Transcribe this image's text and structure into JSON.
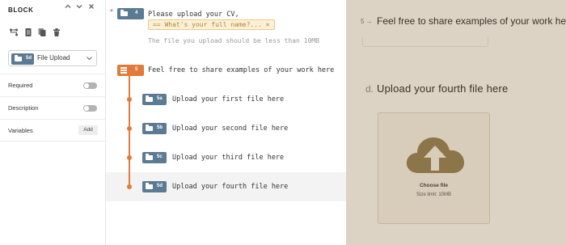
{
  "block_panel": {
    "title": "BLOCK",
    "header_icons": [
      "chevron-up-icon",
      "chevron-down-icon",
      "close-icon"
    ],
    "tools": [
      "branch-icon",
      "document-icon",
      "duplicate-icon",
      "trash-icon"
    ],
    "block_type": {
      "badge": "5d",
      "label": "File Upload"
    },
    "settings": [
      {
        "label": "Required",
        "type": "toggle",
        "on": false
      },
      {
        "label": "Description",
        "type": "toggle",
        "on": false
      },
      {
        "label": "Variables",
        "type": "button",
        "button_label": "Add"
      }
    ]
  },
  "flow": {
    "question4": {
      "required_mark": "*",
      "badge": "4",
      "text": "Please upload your CV,",
      "chip": "== What's your full name?... ×",
      "hint": "The file you upload should be less than 10MB"
    },
    "group": {
      "badge": "5",
      "title": "Feel free to share examples of your work here",
      "children": [
        {
          "badge": "5a",
          "text": "Upload your first file here",
          "active": false
        },
        {
          "badge": "5b",
          "text": "Upload your second file here",
          "active": false
        },
        {
          "badge": "5c",
          "text": "Upload your third file here",
          "active": false
        },
        {
          "badge": "5d",
          "text": "Upload your fourth file here",
          "active": true
        }
      ]
    }
  },
  "preview": {
    "question_number": "5 →",
    "question_title": "Feel free to share examples of your work here",
    "sub_letter": "d.",
    "sub_title": "Upload your fourth file here",
    "upload": {
      "choose_label": "Choose file",
      "size_limit": "Size limit: 10MB"
    }
  },
  "colors": {
    "badge_blue": "#5b7a94",
    "group_orange": "#e07b39",
    "preview_bg": "#ddd3c4",
    "upload_icon": "#8c7548"
  }
}
